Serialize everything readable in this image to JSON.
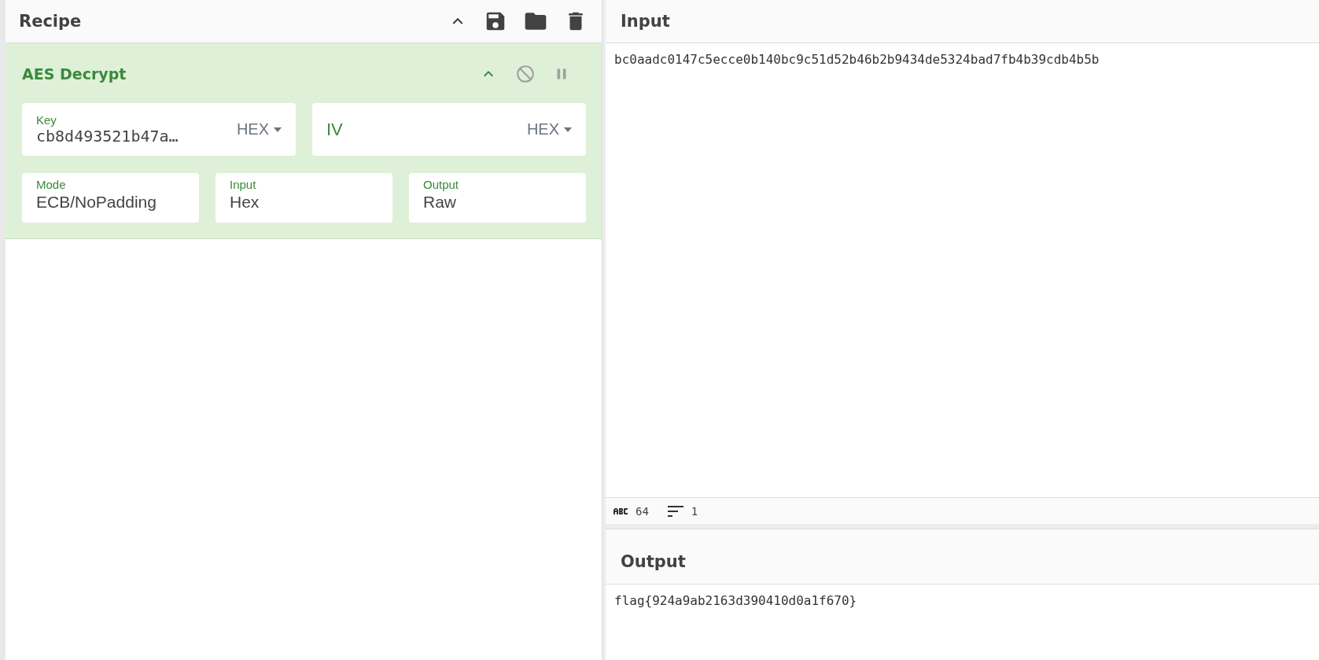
{
  "recipe": {
    "title": "Recipe"
  },
  "operation": {
    "title": "AES Decrypt",
    "args": [
      {
        "kind": "toggle",
        "label": "Key",
        "value": "cb8d493521b47a…",
        "format": "HEX"
      },
      {
        "kind": "toggle",
        "placeholder": "IV",
        "format": "HEX"
      },
      {
        "kind": "select",
        "label": "Mode",
        "value": "ECB/NoPadding"
      },
      {
        "kind": "select",
        "label": "Input",
        "value": "Hex"
      },
      {
        "kind": "select",
        "label": "Output",
        "value": "Raw"
      }
    ]
  },
  "input": {
    "title": "Input",
    "text": "bc0aadc0147c5ecce0b140bc9c51d52b46b2b9434de5324bad7fb4b39cdb4b5b",
    "char_count": "64",
    "line_count": "1"
  },
  "output": {
    "title": "Output",
    "text": "flag{924a9ab2163d390410d0a1f670}"
  }
}
